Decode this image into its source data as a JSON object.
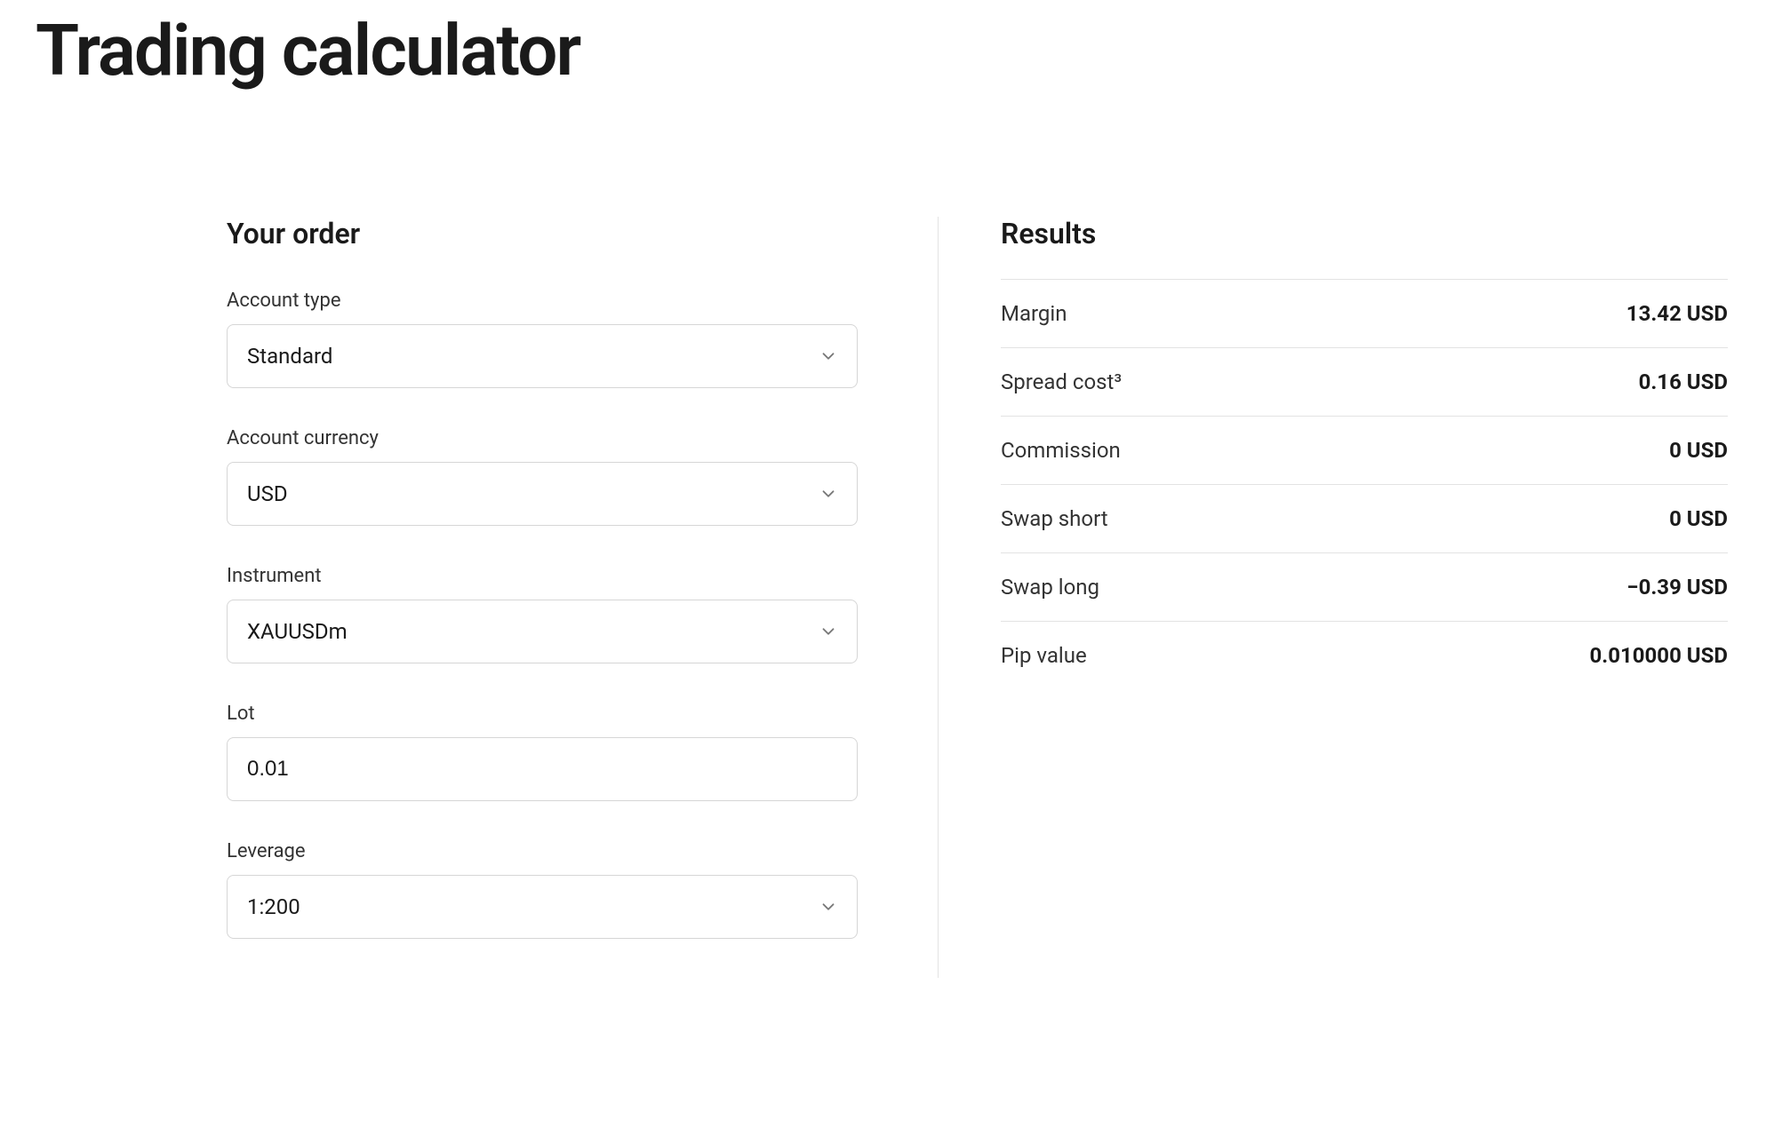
{
  "page": {
    "title": "Trading calculator"
  },
  "order": {
    "heading": "Your order",
    "fields": {
      "account_type": {
        "label": "Account type",
        "value": "Standard"
      },
      "account_currency": {
        "label": "Account currency",
        "value": "USD"
      },
      "instrument": {
        "label": "Instrument",
        "value": "XAUUSDm"
      },
      "lot": {
        "label": "Lot",
        "value": "0.01"
      },
      "leverage": {
        "label": "Leverage",
        "value": "1:200"
      }
    }
  },
  "results": {
    "heading": "Results",
    "rows": {
      "margin": {
        "label": "Margin",
        "value": "13.42 USD"
      },
      "spread_cost": {
        "label": "Spread cost³",
        "value": "0.16 USD"
      },
      "commission": {
        "label": "Commission",
        "value": "0 USD"
      },
      "swap_short": {
        "label": "Swap short",
        "value": "0 USD"
      },
      "swap_long": {
        "label": "Swap long",
        "value": "−0.39 USD"
      },
      "pip_value": {
        "label": "Pip value",
        "value": "0.010000 USD"
      }
    }
  }
}
